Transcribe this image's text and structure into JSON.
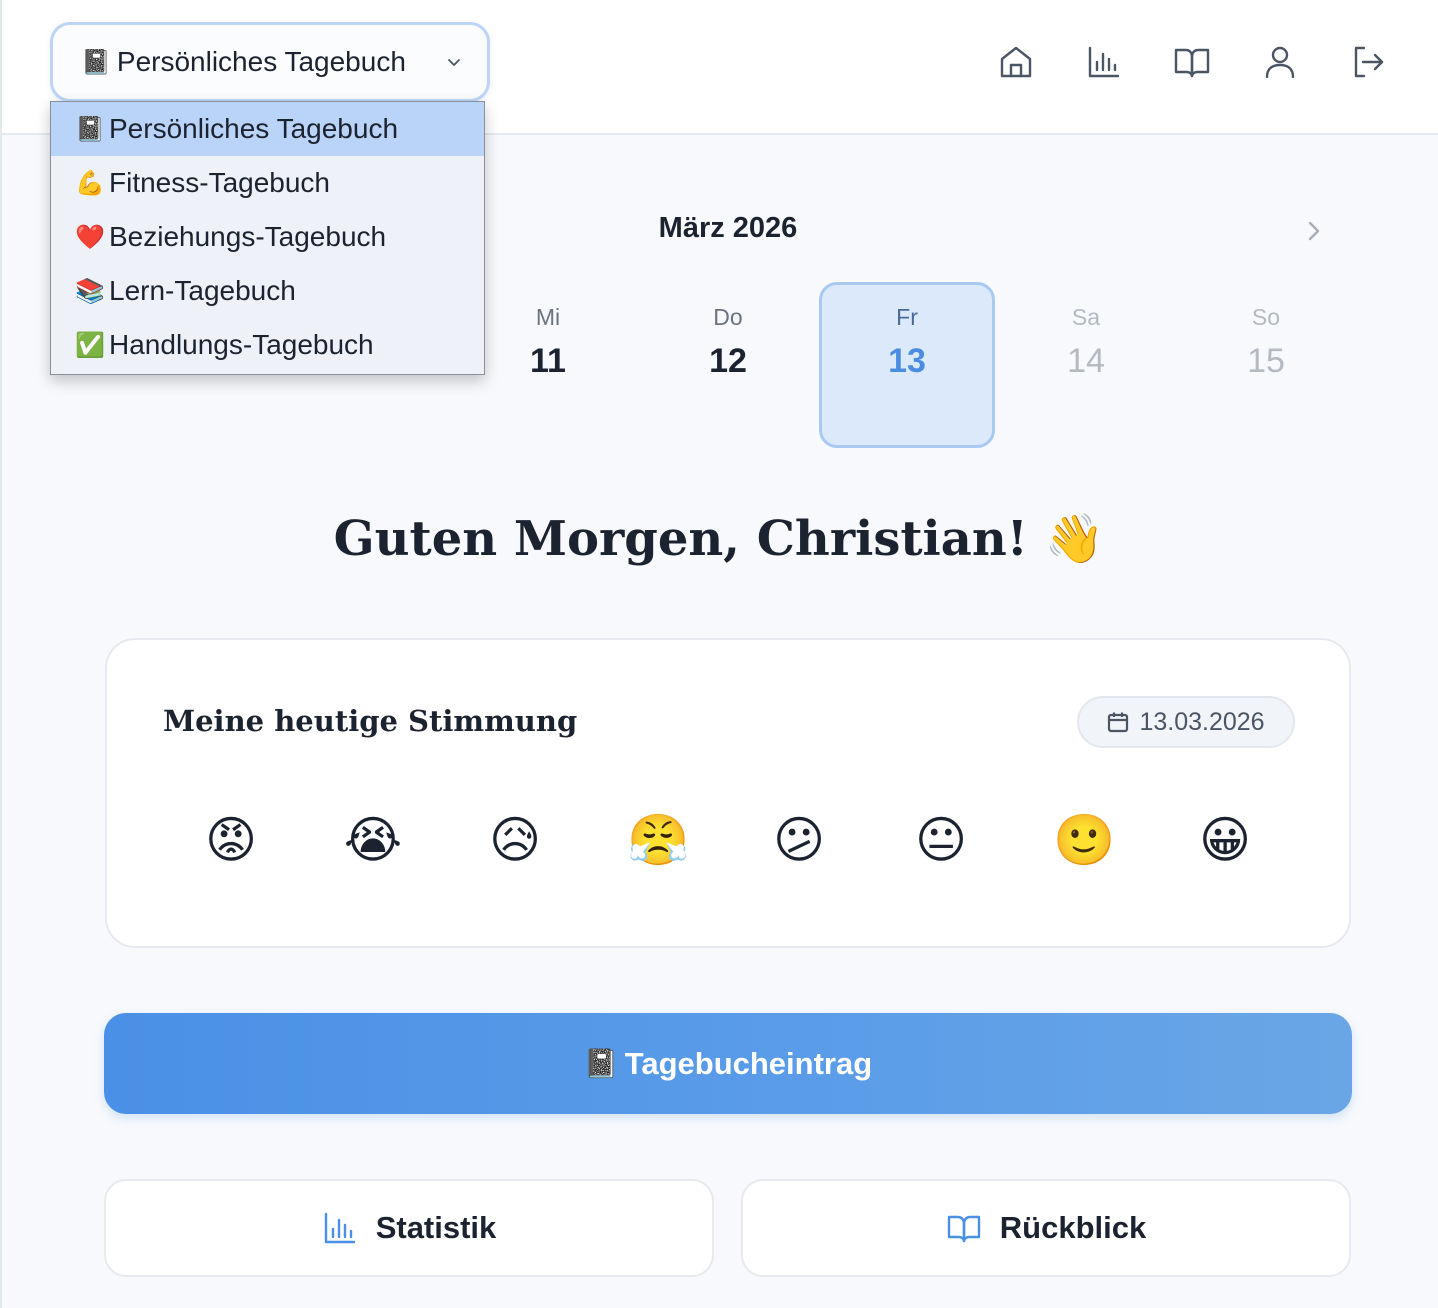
{
  "header": {
    "journal_select": {
      "emoji": "📓",
      "label": "Persönliches Tagebuch",
      "icon": "chevron-down-icon"
    },
    "nav": [
      {
        "name": "home-icon"
      },
      {
        "name": "bar-chart-icon"
      },
      {
        "name": "book-open-icon"
      },
      {
        "name": "user-icon"
      },
      {
        "name": "logout-icon"
      }
    ]
  },
  "dropdown": {
    "items": [
      {
        "emoji": "📓",
        "label": "Persönliches Tagebuch",
        "selected": true
      },
      {
        "emoji": "💪",
        "label": "Fitness-Tagebuch"
      },
      {
        "emoji": "❤️",
        "label": "Beziehungs-Tagebuch"
      },
      {
        "emoji": "📚",
        "label": "Lern-Tagebuch"
      },
      {
        "emoji": "✅",
        "label": "Handlungs-Tagebuch"
      }
    ]
  },
  "calendar": {
    "month": "März 2026",
    "days": [
      {
        "dow": "Mi",
        "num": "11"
      },
      {
        "dow": "Do",
        "num": "12"
      },
      {
        "dow": "Fr",
        "num": "13"
      },
      {
        "dow": "Sa",
        "num": "14"
      },
      {
        "dow": "So",
        "num": "15"
      }
    ]
  },
  "greeting": "Guten Morgen, Christian! 👋",
  "mood": {
    "title": "Meine heutige Stimmung",
    "date": "13.03.2026",
    "options": [
      "😡",
      "😭",
      "😥",
      "😤",
      "😕",
      "😐",
      "🙂",
      "😀"
    ]
  },
  "actions": {
    "entry": {
      "emoji": "📓",
      "label": "Tagebucheintrag"
    },
    "stats": {
      "label": "Statistik"
    },
    "review": {
      "label": "Rückblick"
    }
  },
  "colors": {
    "accent": "#4a90e6",
    "selected_day_bg": "#dce9fb",
    "dropdown_selected": "#b9d4f8"
  }
}
